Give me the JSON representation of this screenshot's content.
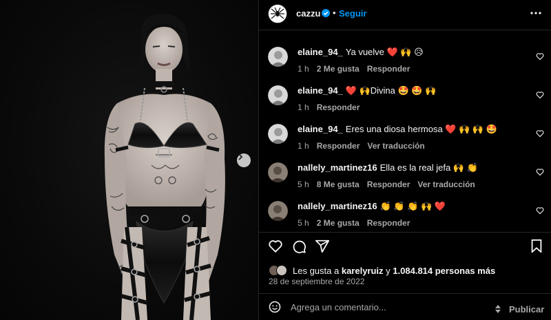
{
  "post": {
    "username": "cazzu",
    "separator": "•",
    "follow_label": "Seguir",
    "more_icon": "more-horizontal-icon"
  },
  "comments": [
    {
      "username": "elaine_94_",
      "text": "Ya vuelve ❤️ 🙌 😥",
      "time": "1 h",
      "likes": "2 Me gusta",
      "reply": "Responder",
      "translate": ""
    },
    {
      "username": "elaine_94_",
      "text": "❤️ 🙌Divina 🤩 🤩 🙌",
      "time": "1 h",
      "likes": "",
      "reply": "Responder",
      "translate": ""
    },
    {
      "username": "elaine_94_",
      "text": "Eres una diosa hermosa ❤️ 🙌 🙌 🤩",
      "time": "1 h",
      "likes": "",
      "reply": "Responder",
      "translate": "Ver traducción"
    },
    {
      "username": "nallely_martinez16",
      "text": "Ella es la real jefa 🙌 👏",
      "time": "5 h",
      "likes": "8 Me gusta",
      "reply": "Responder",
      "translate": "Ver traducción"
    },
    {
      "username": "nallely_martinez16",
      "text": "👏 👏 👏 🙌 ❤️",
      "time": "5 h",
      "likes": "2 Me gusta",
      "reply": "Responder",
      "translate": ""
    }
  ],
  "likes": {
    "prefix": "Les gusta a",
    "user": "karelyruiz",
    "joiner": "y",
    "count": "1.084.814 personas más"
  },
  "date": "28 de septiembre de 2022",
  "composer": {
    "placeholder": "Agrega un comentario...",
    "publish_label": "Publicar"
  },
  "colors": {
    "accent": "#0095f6",
    "background": "#000000",
    "secondary_text": "#a8a8a8",
    "divider": "#262626"
  }
}
